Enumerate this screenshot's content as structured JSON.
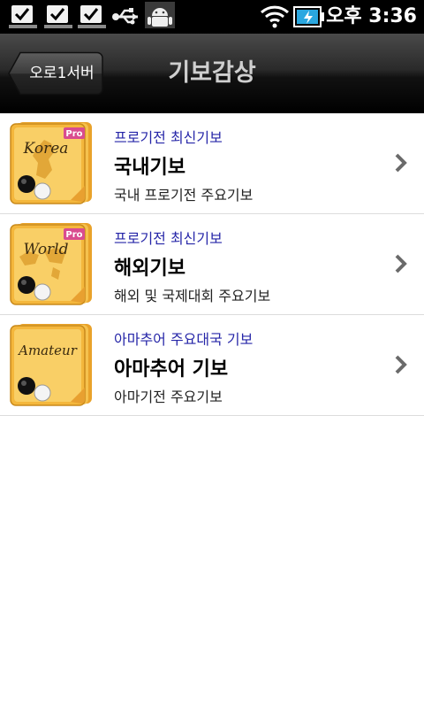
{
  "statusbar": {
    "time": "오후 3:36",
    "icons": [
      "checkbox-notification-icon",
      "checkbox-notification-icon",
      "checkbox-notification-icon",
      "usb-icon",
      "android-debug-icon",
      "wifi-icon",
      "battery-charging-icon"
    ]
  },
  "header": {
    "back_label": "오로1서버",
    "title": "기보감상"
  },
  "list": [
    {
      "icon_label": "Korea",
      "badge": "Pro",
      "subtitle": "프로기전 최신기보",
      "title": "국내기보",
      "description": "국내 프로기전 주요기보"
    },
    {
      "icon_label": "World",
      "badge": "Pro",
      "subtitle": "프로기전 최신기보",
      "title": "해외기보",
      "description": "해외 및 국제대회 주요기보"
    },
    {
      "icon_label": "Amateur",
      "subtitle": "아마추어 주요대국 기보",
      "title": "아마추어 기보",
      "description": "아마기전 주요기보"
    }
  ],
  "colors": {
    "subtitle": "#2626a8",
    "icon_gold": "#f2b53a",
    "badge": "#d94c8f"
  }
}
